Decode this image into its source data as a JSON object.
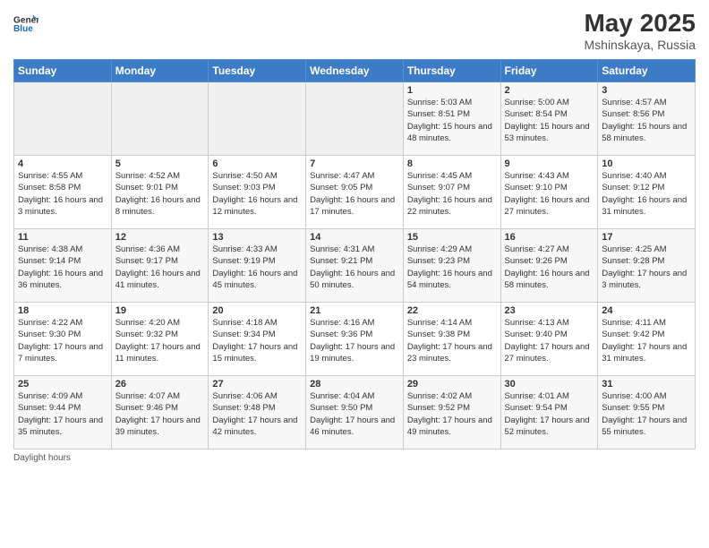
{
  "header": {
    "logo": {
      "general": "General",
      "blue": "Blue"
    },
    "title": "May 2025",
    "subtitle": "Mshinskaya, Russia"
  },
  "calendar": {
    "days_of_week": [
      "Sunday",
      "Monday",
      "Tuesday",
      "Wednesday",
      "Thursday",
      "Friday",
      "Saturday"
    ],
    "weeks": [
      [
        {
          "day": "",
          "info": ""
        },
        {
          "day": "",
          "info": ""
        },
        {
          "day": "",
          "info": ""
        },
        {
          "day": "",
          "info": ""
        },
        {
          "day": "1",
          "sunrise": "5:03 AM",
          "sunset": "8:51 PM",
          "daylight": "15 hours and 48 minutes."
        },
        {
          "day": "2",
          "sunrise": "5:00 AM",
          "sunset": "8:54 PM",
          "daylight": "15 hours and 53 minutes."
        },
        {
          "day": "3",
          "sunrise": "4:57 AM",
          "sunset": "8:56 PM",
          "daylight": "15 hours and 58 minutes."
        }
      ],
      [
        {
          "day": "4",
          "sunrise": "4:55 AM",
          "sunset": "8:58 PM",
          "daylight": "16 hours and 3 minutes."
        },
        {
          "day": "5",
          "sunrise": "4:52 AM",
          "sunset": "9:01 PM",
          "daylight": "16 hours and 8 minutes."
        },
        {
          "day": "6",
          "sunrise": "4:50 AM",
          "sunset": "9:03 PM",
          "daylight": "16 hours and 12 minutes."
        },
        {
          "day": "7",
          "sunrise": "4:47 AM",
          "sunset": "9:05 PM",
          "daylight": "16 hours and 17 minutes."
        },
        {
          "day": "8",
          "sunrise": "4:45 AM",
          "sunset": "9:07 PM",
          "daylight": "16 hours and 22 minutes."
        },
        {
          "day": "9",
          "sunrise": "4:43 AM",
          "sunset": "9:10 PM",
          "daylight": "16 hours and 27 minutes."
        },
        {
          "day": "10",
          "sunrise": "4:40 AM",
          "sunset": "9:12 PM",
          "daylight": "16 hours and 31 minutes."
        }
      ],
      [
        {
          "day": "11",
          "sunrise": "4:38 AM",
          "sunset": "9:14 PM",
          "daylight": "16 hours and 36 minutes."
        },
        {
          "day": "12",
          "sunrise": "4:36 AM",
          "sunset": "9:17 PM",
          "daylight": "16 hours and 41 minutes."
        },
        {
          "day": "13",
          "sunrise": "4:33 AM",
          "sunset": "9:19 PM",
          "daylight": "16 hours and 45 minutes."
        },
        {
          "day": "14",
          "sunrise": "4:31 AM",
          "sunset": "9:21 PM",
          "daylight": "16 hours and 50 minutes."
        },
        {
          "day": "15",
          "sunrise": "4:29 AM",
          "sunset": "9:23 PM",
          "daylight": "16 hours and 54 minutes."
        },
        {
          "day": "16",
          "sunrise": "4:27 AM",
          "sunset": "9:26 PM",
          "daylight": "16 hours and 58 minutes."
        },
        {
          "day": "17",
          "sunrise": "4:25 AM",
          "sunset": "9:28 PM",
          "daylight": "17 hours and 3 minutes."
        }
      ],
      [
        {
          "day": "18",
          "sunrise": "4:22 AM",
          "sunset": "9:30 PM",
          "daylight": "17 hours and 7 minutes."
        },
        {
          "day": "19",
          "sunrise": "4:20 AM",
          "sunset": "9:32 PM",
          "daylight": "17 hours and 11 minutes."
        },
        {
          "day": "20",
          "sunrise": "4:18 AM",
          "sunset": "9:34 PM",
          "daylight": "17 hours and 15 minutes."
        },
        {
          "day": "21",
          "sunrise": "4:16 AM",
          "sunset": "9:36 PM",
          "daylight": "17 hours and 19 minutes."
        },
        {
          "day": "22",
          "sunrise": "4:14 AM",
          "sunset": "9:38 PM",
          "daylight": "17 hours and 23 minutes."
        },
        {
          "day": "23",
          "sunrise": "4:13 AM",
          "sunset": "9:40 PM",
          "daylight": "17 hours and 27 minutes."
        },
        {
          "day": "24",
          "sunrise": "4:11 AM",
          "sunset": "9:42 PM",
          "daylight": "17 hours and 31 minutes."
        }
      ],
      [
        {
          "day": "25",
          "sunrise": "4:09 AM",
          "sunset": "9:44 PM",
          "daylight": "17 hours and 35 minutes."
        },
        {
          "day": "26",
          "sunrise": "4:07 AM",
          "sunset": "9:46 PM",
          "daylight": "17 hours and 39 minutes."
        },
        {
          "day": "27",
          "sunrise": "4:06 AM",
          "sunset": "9:48 PM",
          "daylight": "17 hours and 42 minutes."
        },
        {
          "day": "28",
          "sunrise": "4:04 AM",
          "sunset": "9:50 PM",
          "daylight": "17 hours and 46 minutes."
        },
        {
          "day": "29",
          "sunrise": "4:02 AM",
          "sunset": "9:52 PM",
          "daylight": "17 hours and 49 minutes."
        },
        {
          "day": "30",
          "sunrise": "4:01 AM",
          "sunset": "9:54 PM",
          "daylight": "17 hours and 52 minutes."
        },
        {
          "day": "31",
          "sunrise": "4:00 AM",
          "sunset": "9:55 PM",
          "daylight": "17 hours and 55 minutes."
        }
      ]
    ]
  },
  "footer": {
    "daylight_label": "Daylight hours"
  }
}
